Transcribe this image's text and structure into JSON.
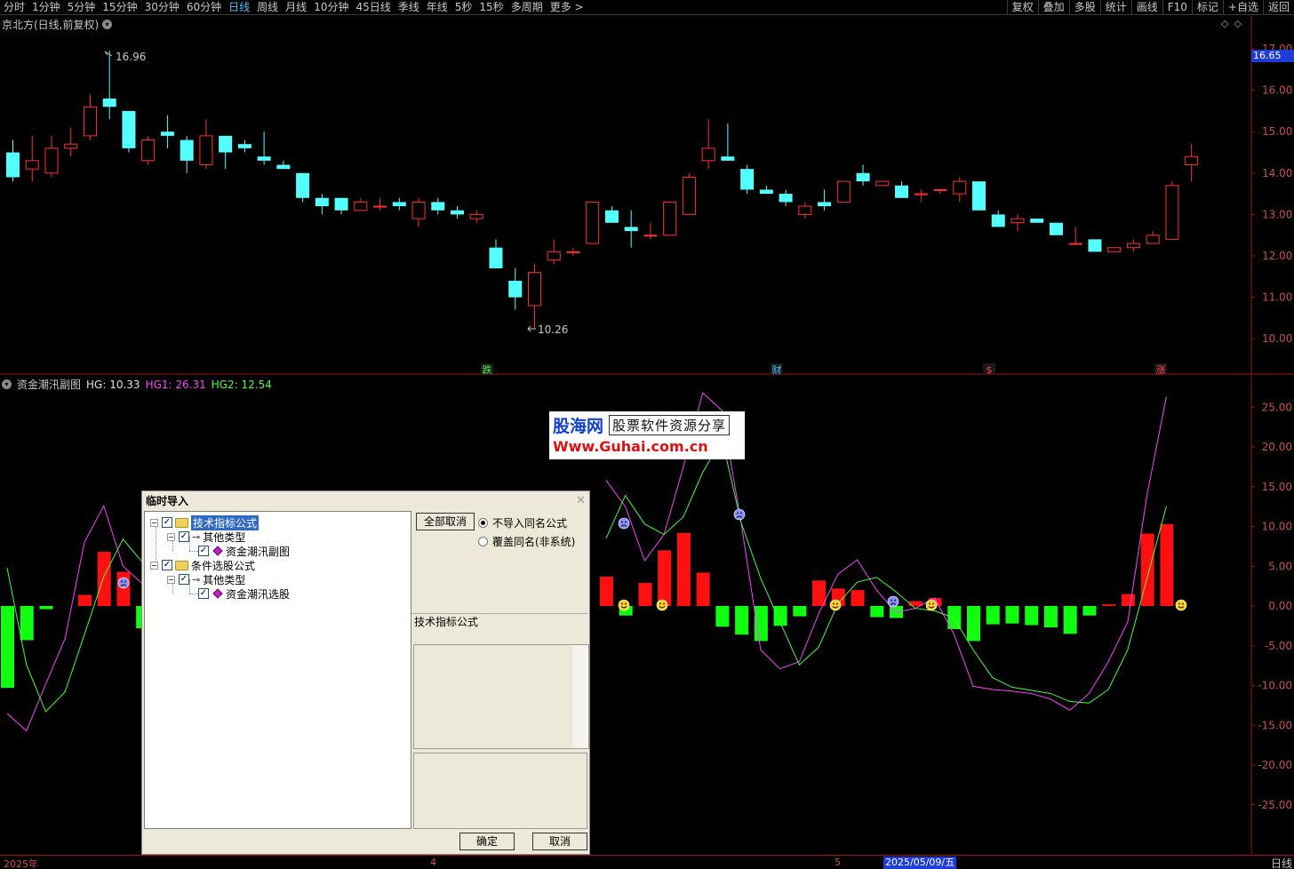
{
  "periods": [
    {
      "label": "分时",
      "active": false
    },
    {
      "label": "1分钟",
      "active": false
    },
    {
      "label": "5分钟",
      "active": false
    },
    {
      "label": "15分钟",
      "active": false
    },
    {
      "label": "30分钟",
      "active": false
    },
    {
      "label": "60分钟",
      "active": false
    },
    {
      "label": "日线",
      "active": true
    },
    {
      "label": "周线",
      "active": false
    },
    {
      "label": "月线",
      "active": false
    },
    {
      "label": "10分钟",
      "active": false
    },
    {
      "label": "45日线",
      "active": false
    },
    {
      "label": "季线",
      "active": false
    },
    {
      "label": "年线",
      "active": false
    },
    {
      "label": "5秒",
      "active": false
    },
    {
      "label": "15秒",
      "active": false
    },
    {
      "label": "多周期",
      "active": false
    },
    {
      "label": "更多 >",
      "active": false
    }
  ],
  "right_buttons": [
    "复权",
    "叠加",
    "多股",
    "统计",
    "画线",
    "F10",
    "标记",
    "+自选",
    "返回"
  ],
  "main_title": "京北方(日线,前复权)",
  "price_tag": "16.65",
  "max_label": "16.96",
  "min_label": "10.26",
  "price_axis": [
    "17.00",
    "16.00",
    "15.00",
    "14.00",
    "13.00",
    "12.00",
    "11.00",
    "10.00"
  ],
  "sub_axis": [
    "25.00",
    "20.00",
    "15.00",
    "10.00",
    "5.00",
    "0.00",
    "-5.00",
    "-10.00",
    "-15.00",
    "-20.00",
    "-25.00"
  ],
  "markers": [
    {
      "label": "跌",
      "color": "#40ff40"
    },
    {
      "label": "财",
      "color": "#4ec3ff"
    },
    {
      "label": "$",
      "color": "#ff4040"
    },
    {
      "label": "涨",
      "color": "#ff4040"
    }
  ],
  "sub_title": {
    "name": "资金潮汛副图",
    "hg": "HG: 10.33",
    "hg1": "HG1: 26.31",
    "hg2": "HG2: 12.54"
  },
  "watermark": {
    "brand": "股海网",
    "tag": "股票软件资源分享",
    "url": "Www.Guhai.com.cn"
  },
  "dialog": {
    "title": "临时导入",
    "tree": [
      {
        "label": "技术指标公式",
        "selected": true
      },
      {
        "label": "其他类型",
        "selected": false
      },
      {
        "label": "资金潮汛副图",
        "selected": false
      },
      {
        "label": "条件选股公式",
        "selected": false
      },
      {
        "label": "其他类型",
        "selected": false
      },
      {
        "label": "资金潮汛选股",
        "selected": false
      }
    ],
    "cancel_all": "全部取消",
    "radio1": "不导入同名公式",
    "radio2": "覆盖同名(非系统)",
    "type_label": "技术指标公式",
    "ok": "确定",
    "cancel": "取消"
  },
  "bottom": {
    "year": "2025年",
    "m4": "4",
    "m5": "5",
    "date": "2025/05/09/五",
    "period": "日线"
  },
  "colors": {
    "up": "#ff3030",
    "down": "#54ffff",
    "hg1": "#ff40ff",
    "hg2": "#40ff40",
    "bar_pos": "#ff1010",
    "bar_neg": "#10ff10"
  },
  "chart_data": {
    "type": "candlestick",
    "candles": [
      {
        "o": 14.5,
        "h": 14.8,
        "l": 13.8,
        "c": 13.9
      },
      {
        "o": 14.1,
        "h": 14.9,
        "l": 13.8,
        "c": 14.3
      },
      {
        "o": 14.0,
        "h": 14.9,
        "l": 13.9,
        "c": 14.6
      },
      {
        "o": 14.6,
        "h": 15.1,
        "l": 14.4,
        "c": 14.7
      },
      {
        "o": 14.9,
        "h": 15.9,
        "l": 14.8,
        "c": 15.6
      },
      {
        "o": 15.8,
        "h": 16.96,
        "l": 15.3,
        "c": 15.6
      },
      {
        "o": 15.5,
        "h": 15.5,
        "l": 14.5,
        "c": 14.6
      },
      {
        "o": 14.3,
        "h": 14.9,
        "l": 14.2,
        "c": 14.8
      },
      {
        "o": 15.0,
        "h": 15.4,
        "l": 14.6,
        "c": 14.9
      },
      {
        "o": 14.8,
        "h": 14.9,
        "l": 14.0,
        "c": 14.3
      },
      {
        "o": 14.2,
        "h": 15.3,
        "l": 14.1,
        "c": 14.9
      },
      {
        "o": 14.9,
        "h": 14.9,
        "l": 14.1,
        "c": 14.5
      },
      {
        "o": 14.7,
        "h": 14.8,
        "l": 14.5,
        "c": 14.6
      },
      {
        "o": 14.4,
        "h": 15.0,
        "l": 14.2,
        "c": 14.3
      },
      {
        "o": 14.2,
        "h": 14.3,
        "l": 14.1,
        "c": 14.1
      },
      {
        "o": 14.0,
        "h": 14.0,
        "l": 13.3,
        "c": 13.4
      },
      {
        "o": 13.4,
        "h": 13.5,
        "l": 13.0,
        "c": 13.2
      },
      {
        "o": 13.4,
        "h": 13.4,
        "l": 13.0,
        "c": 13.1
      },
      {
        "o": 13.1,
        "h": 13.4,
        "l": 13.1,
        "c": 13.3
      },
      {
        "o": 13.2,
        "h": 13.4,
        "l": 13.1,
        "c": 13.2
      },
      {
        "o": 13.3,
        "h": 13.4,
        "l": 13.1,
        "c": 13.2
      },
      {
        "o": 12.9,
        "h": 13.4,
        "l": 12.7,
        "c": 13.3
      },
      {
        "o": 13.3,
        "h": 13.4,
        "l": 13.0,
        "c": 13.1
      },
      {
        "o": 13.1,
        "h": 13.2,
        "l": 12.9,
        "c": 13.0
      },
      {
        "o": 12.9,
        "h": 13.1,
        "l": 12.8,
        "c": 13.0
      },
      {
        "o": 12.2,
        "h": 12.4,
        "l": 11.7,
        "c": 11.7
      },
      {
        "o": 11.4,
        "h": 11.7,
        "l": 10.7,
        "c": 11.0
      },
      {
        "o": 10.8,
        "h": 11.8,
        "l": 10.26,
        "c": 11.6
      },
      {
        "o": 11.9,
        "h": 12.4,
        "l": 11.8,
        "c": 12.1
      },
      {
        "o": 12.1,
        "h": 12.2,
        "l": 12.0,
        "c": 12.1
      },
      {
        "o": 12.3,
        "h": 13.3,
        "l": 12.3,
        "c": 13.3
      },
      {
        "o": 13.1,
        "h": 13.2,
        "l": 12.8,
        "c": 12.8
      },
      {
        "o": 12.7,
        "h": 13.1,
        "l": 12.2,
        "c": 12.6
      },
      {
        "o": 12.5,
        "h": 12.8,
        "l": 12.4,
        "c": 12.5
      },
      {
        "o": 12.5,
        "h": 13.3,
        "l": 12.5,
        "c": 13.3
      },
      {
        "o": 13.0,
        "h": 14.0,
        "l": 13.0,
        "c": 13.9
      },
      {
        "o": 14.3,
        "h": 15.3,
        "l": 14.1,
        "c": 14.6
      },
      {
        "o": 14.4,
        "h": 15.2,
        "l": 14.3,
        "c": 14.3
      },
      {
        "o": 14.1,
        "h": 14.2,
        "l": 13.5,
        "c": 13.6
      },
      {
        "o": 13.6,
        "h": 13.7,
        "l": 13.5,
        "c": 13.5
      },
      {
        "o": 13.5,
        "h": 13.6,
        "l": 13.2,
        "c": 13.3
      },
      {
        "o": 13.0,
        "h": 13.3,
        "l": 12.9,
        "c": 13.2
      },
      {
        "o": 13.3,
        "h": 13.6,
        "l": 13.1,
        "c": 13.2
      },
      {
        "o": 13.3,
        "h": 13.8,
        "l": 13.3,
        "c": 13.8
      },
      {
        "o": 14.0,
        "h": 14.2,
        "l": 13.7,
        "c": 13.8
      },
      {
        "o": 13.7,
        "h": 13.8,
        "l": 13.7,
        "c": 13.8
      },
      {
        "o": 13.7,
        "h": 13.8,
        "l": 13.4,
        "c": 13.4
      },
      {
        "o": 13.5,
        "h": 13.6,
        "l": 13.3,
        "c": 13.5
      },
      {
        "o": 13.6,
        "h": 13.6,
        "l": 13.5,
        "c": 13.6
      },
      {
        "o": 13.5,
        "h": 13.9,
        "l": 13.3,
        "c": 13.8
      },
      {
        "o": 13.8,
        "h": 13.8,
        "l": 13.1,
        "c": 13.1
      },
      {
        "o": 13.0,
        "h": 13.1,
        "l": 12.7,
        "c": 12.7
      },
      {
        "o": 12.8,
        "h": 13.0,
        "l": 12.6,
        "c": 12.9
      },
      {
        "o": 12.9,
        "h": 12.9,
        "l": 12.8,
        "c": 12.8
      },
      {
        "o": 12.8,
        "h": 12.8,
        "l": 12.5,
        "c": 12.5
      },
      {
        "o": 12.3,
        "h": 12.7,
        "l": 12.3,
        "c": 12.3
      },
      {
        "o": 12.4,
        "h": 12.4,
        "l": 12.1,
        "c": 12.1
      },
      {
        "o": 12.1,
        "h": 12.2,
        "l": 12.1,
        "c": 12.2
      },
      {
        "o": 12.2,
        "h": 12.4,
        "l": 12.1,
        "c": 12.3
      },
      {
        "o": 12.3,
        "h": 12.6,
        "l": 12.3,
        "c": 12.5
      },
      {
        "o": 12.4,
        "h": 13.8,
        "l": 12.4,
        "c": 13.7
      },
      {
        "o": 14.2,
        "h": 14.7,
        "l": 13.8,
        "c": 14.4
      }
    ],
    "hist": [
      -10.3,
      -4.3,
      -0.4,
      0,
      1.4,
      6.8,
      4.3,
      -2.8,
      -2.5,
      0,
      0,
      0,
      0,
      0,
      0,
      0,
      0,
      0,
      0,
      0,
      0,
      0,
      0,
      0,
      0,
      0,
      0,
      0,
      0,
      0,
      0,
      3.7,
      -1.2,
      2.9,
      7.0,
      9.2,
      4.2,
      -2.6,
      -3.6,
      -4.4,
      -2.5,
      -1.3,
      3.2,
      2.2,
      2.0,
      -1.4,
      -1.5,
      0.6,
      1.0,
      -2.9,
      -4.4,
      -2.3,
      -2.2,
      -2.4,
      -2.7,
      -3.5,
      -1.2,
      0.2,
      1.5,
      9.1,
      10.3
    ],
    "hg1": [
      -13.5,
      -15.7,
      -9.8,
      -4.1,
      8.0,
      12.6,
      5.0,
      2.8,
      0,
      0,
      0,
      0,
      0,
      0,
      0,
      0,
      0,
      0,
      0,
      0,
      0,
      0,
      0,
      0,
      0,
      0,
      0,
      0,
      0,
      0,
      0,
      15.8,
      12.5,
      5.7,
      9.0,
      17.5,
      26.8,
      24.6,
      10.3,
      -5.5,
      -7.9,
      -7.0,
      -1.0,
      4.0,
      5.8,
      2.0,
      -0.8,
      -0.3,
      1.0,
      -3.5,
      -10.1,
      -10.5,
      -10.7,
      -11.0,
      -11.7,
      -13.1,
      -11.0,
      -7.0,
      -2.0,
      14.0,
      26.31
    ],
    "hg2": [
      4.8,
      -7.4,
      -13.3,
      -10.8,
      -3.6,
      3.7,
      8.4,
      5.5,
      0,
      0,
      0,
      0,
      0,
      0,
      0,
      0,
      0,
      0,
      0,
      0,
      0,
      0,
      0,
      0,
      0,
      0,
      0,
      0,
      0,
      0,
      0,
      8.5,
      13.9,
      10.3,
      9.0,
      11.2,
      16.8,
      21.0,
      10.4,
      3.5,
      -2.0,
      -7.4,
      -5.2,
      0.3,
      3.0,
      3.6,
      1.8,
      -0.3,
      -0.6,
      -1.5,
      -5.5,
      -9.0,
      -10.2,
      -10.6,
      -11.0,
      -12.0,
      -12.2,
      -10.5,
      -5.5,
      3.5,
      12.54
    ]
  }
}
